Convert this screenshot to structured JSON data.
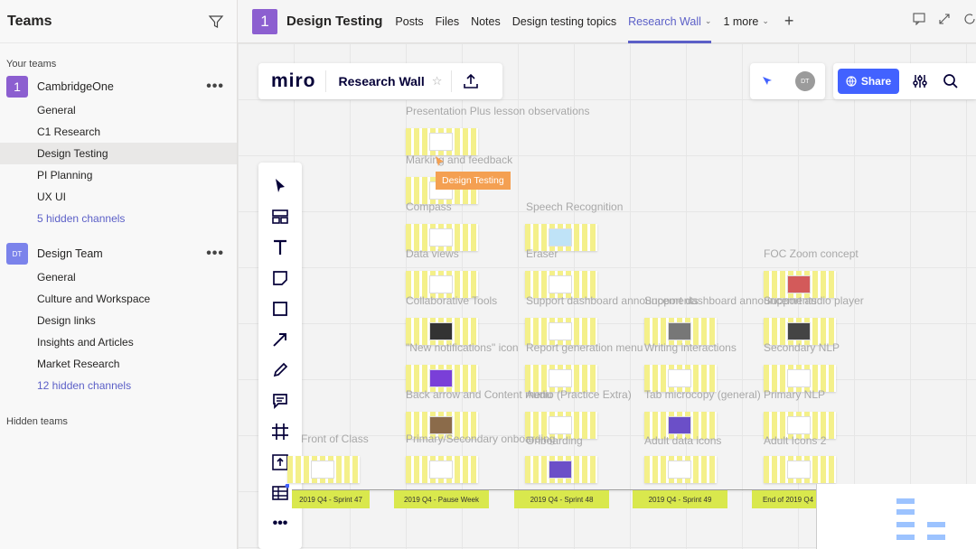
{
  "sidebar": {
    "title": "Teams",
    "your_teams_label": "Your teams",
    "teams": [
      {
        "name": "CambridgeOne",
        "avatar": "1",
        "color": "#8c5fd0",
        "channels": [
          "General",
          "C1 Research",
          "Design Testing",
          "PI Planning",
          "UX UI"
        ],
        "hidden": "5 hidden channels"
      },
      {
        "name": "Design Team",
        "avatar": "DT",
        "color": "#7b83eb",
        "channels": [
          "General",
          "Culture and Workspace",
          "Design links",
          "Insights and Articles",
          "Market Research"
        ],
        "hidden": "12 hidden channels"
      }
    ],
    "hidden_teams_label": "Hidden teams"
  },
  "topbar": {
    "avatar": "1",
    "title": "Design Testing",
    "tabs": [
      "Posts",
      "Files",
      "Notes",
      "Design testing topics",
      "Research Wall",
      "1 more"
    ]
  },
  "miro": {
    "logo": "miro",
    "board_name": "Research Wall",
    "avatar": "DT",
    "share": "Share",
    "tooltip": "Design Testing",
    "frames": [
      {
        "label": "Presentation Plus lesson observations"
      },
      {
        "label": "Marking and feedback"
      },
      {
        "label": "Compass"
      },
      {
        "label": "Speech Recognition"
      },
      {
        "label": "Data views"
      },
      {
        "label": "Eraser"
      },
      {
        "label": "FOC Zoom concept"
      },
      {
        "label": "Collaborative Tools"
      },
      {
        "label": "Support dashboard announcements"
      },
      {
        "label": "Support dashboard announcements"
      },
      {
        "label": "Support audio player"
      },
      {
        "label": "\"New notifications\" icon"
      },
      {
        "label": "Report generation menu"
      },
      {
        "label": "Writing interactions"
      },
      {
        "label": "Secondary NLP"
      },
      {
        "label": "Back arrow and Content menu"
      },
      {
        "label": "Audio (Practice Extra)"
      },
      {
        "label": "Tab microcopy (general)"
      },
      {
        "label": "Primary NLP"
      },
      {
        "label": "Front of Class"
      },
      {
        "label": "Primary/Secondary onboarding"
      },
      {
        "label": "Onboarding"
      },
      {
        "label": "Adult data icons"
      },
      {
        "label": "Adult Icons 2"
      }
    ],
    "sprints": [
      "2019 Q4 - Sprint 47",
      "2019 Q4 - Pause Week",
      "2019 Q4 - Sprint 48",
      "2019 Q4 - Sprint 49",
      "End of 2019 Q4"
    ]
  }
}
